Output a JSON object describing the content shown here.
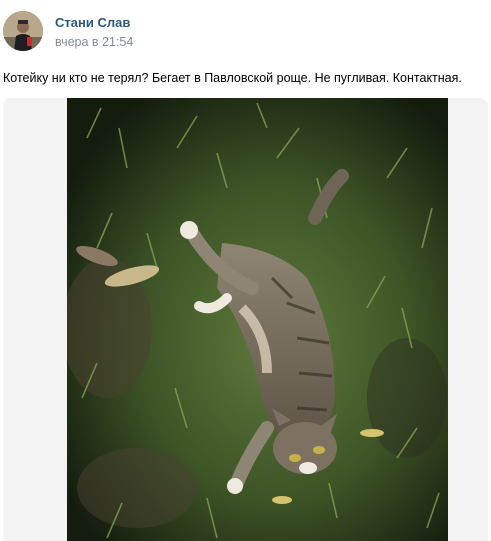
{
  "author": {
    "name": "Стани Слав"
  },
  "post": {
    "time": "вчера в 21:54",
    "text": "Котейку ни кто не терял? Бегает в Павловской роще. Не пугливая. Контактная."
  },
  "icons": {
    "avatar": "user-avatar-photo",
    "photo": "cat-photo"
  },
  "colors": {
    "link": "#2a5885",
    "meta": "#818c99",
    "media_bg": "#f3f3f4"
  }
}
